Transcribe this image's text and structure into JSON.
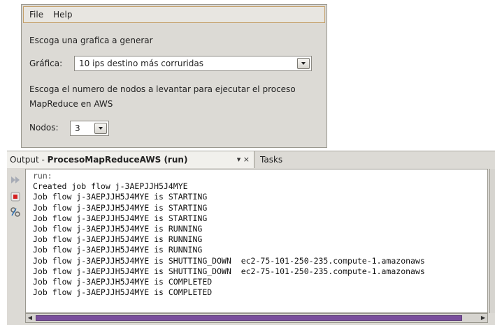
{
  "menu": {
    "items": [
      {
        "label": "File"
      },
      {
        "label": "Help"
      }
    ]
  },
  "form": {
    "prompt_chart": "Escoga una grafica a generar",
    "chart_label": "Gráfica:",
    "chart_value": "10 ips destino más corruridas",
    "prompt_nodes_line1": "Escoga el numero de nodos a levantar para ejecutar el proceso",
    "prompt_nodes_line2": "MapReduce en AWS",
    "nodes_label": "Nodos:",
    "nodes_value": "3"
  },
  "output_panel": {
    "tab_prefix": "Output - ",
    "tab_title": "ProcesoMapReduceAWS (run)",
    "tab_controls": "▾ ×",
    "tasks_tab": "Tasks",
    "toolbar_icons": [
      "rerun-icon",
      "stop-icon",
      "settings-icon"
    ],
    "lines": [
      "run:",
      "Created job flow j-3AEPJJH5J4MYE",
      "Job flow j-3AEPJJH5J4MYE is STARTING",
      "Job flow j-3AEPJJH5J4MYE is STARTING",
      "Job flow j-3AEPJJH5J4MYE is STARTING",
      "Job flow j-3AEPJJH5J4MYE is RUNNING",
      "Job flow j-3AEPJJH5J4MYE is RUNNING",
      "Job flow j-3AEPJJH5J4MYE is RUNNING",
      "Job flow j-3AEPJJH5J4MYE is SHUTTING_DOWN  ec2-75-101-250-235.compute-1.amazonaws",
      "Job flow j-3AEPJJH5J4MYE is SHUTTING_DOWN  ec2-75-101-250-235.compute-1.amazonaws",
      "Job flow j-3AEPJJH5J4MYE is COMPLETED",
      "Job flow j-3AEPJJH5J4MYE is COMPLETED"
    ]
  },
  "colors": {
    "scroll_thumb": "#7a4f9c",
    "menu_border": "#c4a06a",
    "stop_red": "#d42020"
  }
}
